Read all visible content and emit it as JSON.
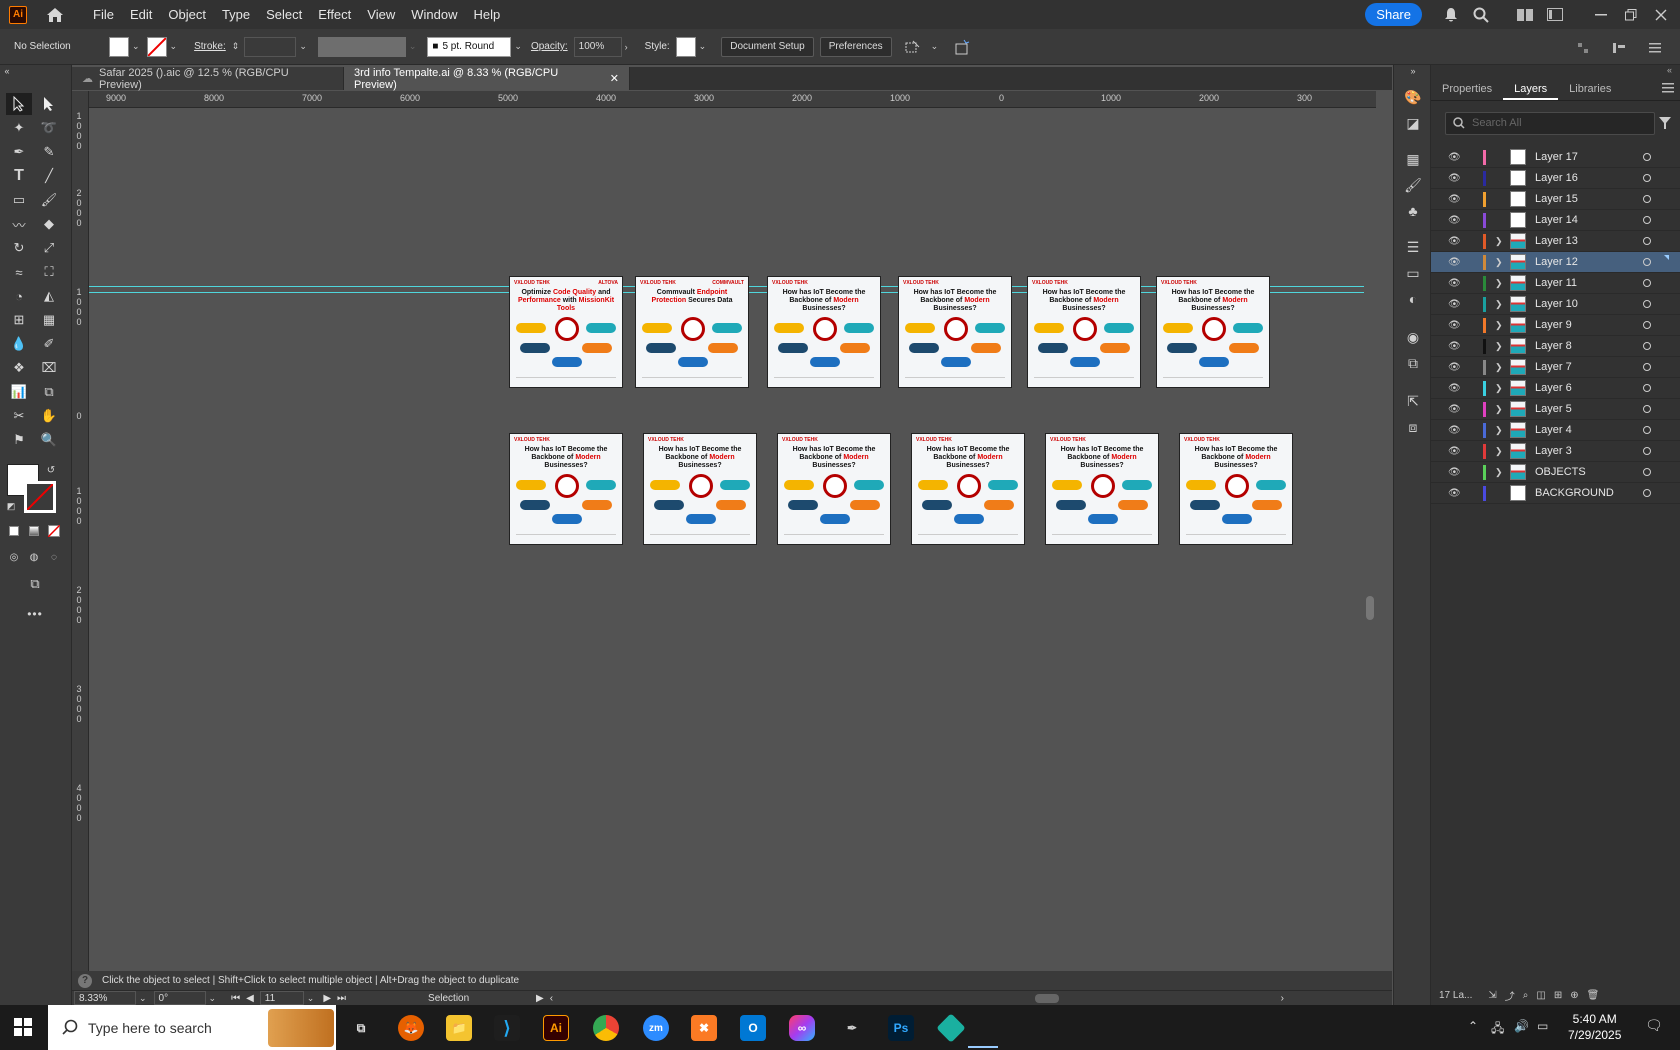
{
  "menubar": {
    "logo": "Ai",
    "menus": [
      "File",
      "Edit",
      "Object",
      "Type",
      "Select",
      "Effect",
      "View",
      "Window",
      "Help"
    ],
    "share": "Share"
  },
  "control": {
    "selection": "No Selection",
    "stroke_label": "Stroke:",
    "brush": "5 pt. Round",
    "opacity_label": "Opacity:",
    "opacity": "100%",
    "style_label": "Style:",
    "doc_setup": "Document Setup",
    "preferences": "Preferences"
  },
  "tabs": [
    {
      "label": "Safar 2025 ().aic @ 12.5 % (RGB/CPU Preview)"
    },
    {
      "label": "3rd info Tempalte.ai @ 8.33 % (RGB/CPU Preview)"
    }
  ],
  "ruler": {
    "h": [
      "9000",
      "8000",
      "7000",
      "6000",
      "5000",
      "4000",
      "3000",
      "2000",
      "1000",
      "0",
      "1000",
      "2000",
      "300"
    ],
    "v": [
      "1000",
      "2000",
      "1000",
      "0",
      "1000",
      "2000",
      "3000",
      "4000"
    ]
  },
  "artboards": [
    {
      "logo": "VXLOUD TEHK",
      "t1": "Optimize ",
      "r1": "Code Quality",
      "t2": " and ",
      "r2": "Performance",
      "t3": " with ",
      "r3": "MissionKit Tools",
      "badge": "ALTOVA"
    },
    {
      "logo": "VXLOUD TEHK",
      "t1": "Commvault ",
      "r1": "Endpoint Protection",
      "t2": " Secures Data",
      "r2": "",
      "t3": "",
      "r3": "",
      "badge": "COMMVAULT"
    },
    {
      "logo": "VXLOUD TEHK",
      "t1": "How has IoT Become the Backbone of ",
      "r1": "Modern",
      "t2": " Businesses?",
      "r2": "",
      "t3": "",
      "r3": "",
      "badge": ""
    },
    {
      "logo": "VXLOUD TEHK",
      "t1": "How has IoT Become the Backbone of ",
      "r1": "Modern",
      "t2": " Businesses?",
      "r2": "",
      "t3": "",
      "r3": "",
      "badge": ""
    },
    {
      "logo": "VXLOUD TEHK",
      "t1": "How has IoT Become the Backbone of ",
      "r1": "Modern",
      "t2": " Businesses?",
      "r2": "",
      "t3": "",
      "r3": "",
      "badge": ""
    },
    {
      "logo": "VXLOUD TEHK",
      "t1": "How has IoT Become the Backbone of ",
      "r1": "Modern",
      "t2": " Businesses?",
      "r2": "",
      "t3": "",
      "r3": "",
      "badge": ""
    },
    {
      "logo": "VXLOUD TEHK",
      "t1": "How has IoT Become the Backbone of ",
      "r1": "Modern",
      "t2": " Businesses?",
      "r2": "",
      "t3": "",
      "r3": "",
      "badge": ""
    },
    {
      "logo": "VXLOUD TEHK",
      "t1": "How has IoT Become the Backbone of ",
      "r1": "Modern",
      "t2": " Businesses?",
      "r2": "",
      "t3": "",
      "r3": "",
      "badge": ""
    },
    {
      "logo": "VXLOUD TEHK",
      "t1": "How has IoT Become the Backbone of ",
      "r1": "Modern",
      "t2": " Businesses?",
      "r2": "",
      "t3": "",
      "r3": "",
      "badge": ""
    },
    {
      "logo": "VXLOUD TEHK",
      "t1": "How has IoT Become the Backbone of ",
      "r1": "Modern",
      "t2": " Businesses?",
      "r2": "",
      "t3": "",
      "r3": "",
      "badge": ""
    },
    {
      "logo": "VXLOUD TEHK",
      "t1": "How has IoT Become the Backbone of ",
      "r1": "Modern",
      "t2": " Businesses?",
      "r2": "",
      "t3": "",
      "r3": "",
      "badge": ""
    },
    {
      "logo": "VXLOUD TEHK",
      "t1": "How has IoT Become the Backbone of ",
      "r1": "Modern",
      "t2": " Businesses?",
      "r2": "",
      "t3": "",
      "r3": "",
      "badge": ""
    }
  ],
  "panel": {
    "tabs": [
      "Properties",
      "Layers",
      "Libraries"
    ],
    "search_placeholder": "Search All",
    "footer": "17 La...",
    "layers": [
      {
        "name": "Layer 17",
        "color": "#f26aa8",
        "expand": false,
        "thumb": "white"
      },
      {
        "name": "Layer 16",
        "color": "#2a2aa0",
        "expand": false,
        "thumb": "white"
      },
      {
        "name": "Layer 15",
        "color": "#f0a030",
        "expand": false,
        "thumb": "white"
      },
      {
        "name": "Layer 14",
        "color": "#8a4ad8",
        "expand": false,
        "thumb": "white"
      },
      {
        "name": "Layer 13",
        "color": "#e05a28",
        "expand": true,
        "thumb": "art"
      },
      {
        "name": "Layer 12",
        "color": "#d08a3a",
        "expand": true,
        "thumb": "art",
        "selected": true
      },
      {
        "name": "Layer 11",
        "color": "#2a8a3a",
        "expand": true,
        "thumb": "art"
      },
      {
        "name": "Layer 10",
        "color": "#1aa0a0",
        "expand": true,
        "thumb": "art"
      },
      {
        "name": "Layer 9",
        "color": "#f0782a",
        "expand": true,
        "thumb": "art"
      },
      {
        "name": "Layer 8",
        "color": "#111111",
        "expand": true,
        "thumb": "art"
      },
      {
        "name": "Layer 7",
        "color": "#888888",
        "expand": true,
        "thumb": "art"
      },
      {
        "name": "Layer 6",
        "color": "#3ad0e0",
        "expand": true,
        "thumb": "art"
      },
      {
        "name": "Layer 5",
        "color": "#e040c0",
        "expand": true,
        "thumb": "art"
      },
      {
        "name": "Layer 4",
        "color": "#4a6ad8",
        "expand": true,
        "thumb": "art"
      },
      {
        "name": "Layer 3",
        "color": "#e03a3a",
        "expand": true,
        "thumb": "art"
      },
      {
        "name": "OBJECTS",
        "color": "#5ad05a",
        "expand": true,
        "thumb": "art"
      },
      {
        "name": "BACKGROUND",
        "color": "#4a4ae0",
        "expand": false,
        "thumb": "white"
      }
    ]
  },
  "status": {
    "hint": "Click the object to select  |  Shift+Click to select multiple object  |  Alt+Drag the object to duplicate",
    "zoom": "8.33%",
    "rotation": "0°",
    "artboard_num": "11",
    "tool": "Selection"
  },
  "taskbar": {
    "search": "Type here to search",
    "time": "5:40 AM",
    "date": "7/29/2025"
  }
}
